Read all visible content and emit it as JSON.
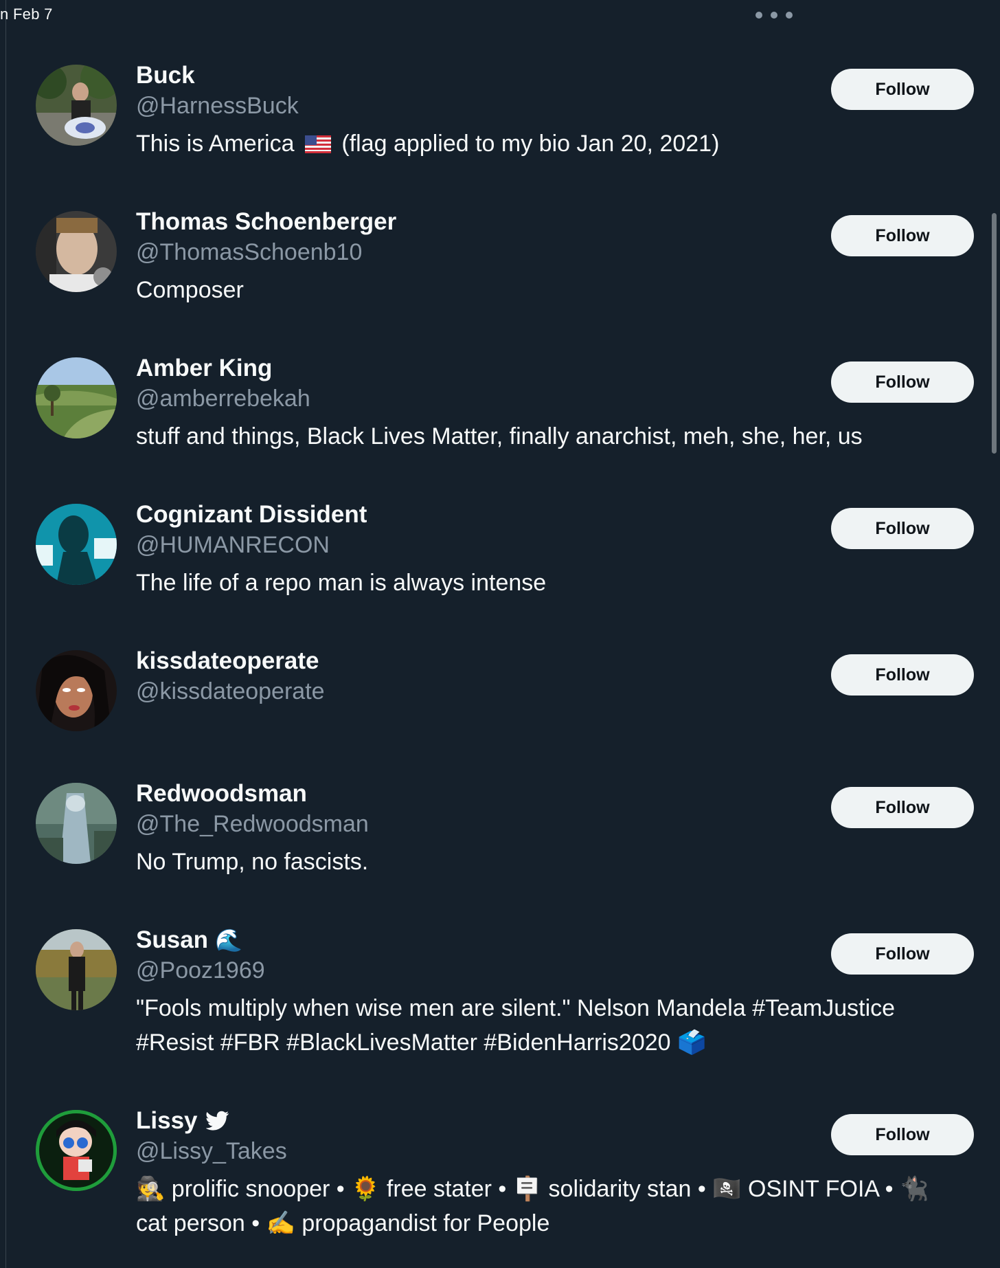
{
  "header": {
    "date_fragment": "n Feb 7",
    "more_icon": "ellipsis-icon"
  },
  "users": [
    {
      "name": "Buck",
      "handle": "@HarnessBuck",
      "bio_before_flag": "This is America ",
      "bio_after_flag": " (flag applied to my bio Jan 20, 2021)",
      "follow_label": "Follow"
    },
    {
      "name": "Thomas Schoenberger",
      "handle": "@ThomasSchoenb10",
      "bio": "Composer",
      "follow_label": "Follow"
    },
    {
      "name": "Amber King",
      "handle": "@amberrebekah",
      "bio": "stuff and things, Black Lives Matter, finally anarchist, meh, she, her, us",
      "follow_label": "Follow"
    },
    {
      "name": "Cognizant Dissident",
      "handle": "@HUMANRECON",
      "bio": "The life of a repo man is always intense",
      "follow_label": "Follow"
    },
    {
      "name": "kissdateoperate",
      "handle": "@kissdateoperate",
      "follow_label": "Follow"
    },
    {
      "name": "Redwoodsman",
      "handle": "@The_Redwoodsman",
      "bio": "No Trump, no fascists.",
      "follow_label": "Follow"
    },
    {
      "name": "Susan",
      "name_emoji": "🌊",
      "handle": "@Pooz1969",
      "bio": "\"Fools multiply when wise men are silent.\" Nelson Mandela #TeamJustice #Resist #FBR #BlackLivesMatter #BidenHarris2020 🗳️",
      "follow_label": "Follow"
    },
    {
      "name": "Lissy",
      "handle": "@Lissy_Takes",
      "bio": "🕵️ prolific snooper • 🌻 free stater • 🪧 solidarity stan • 🏴‍☠️ OSINT FOIA • 🐈‍⬛ cat person • ✍️ propagandist for People",
      "follow_label": "Follow"
    }
  ],
  "colors": {
    "background": "#15202b",
    "primary_text": "#f7f9f9",
    "secondary_text": "#8b98a5",
    "button_bg": "#eff3f4",
    "button_text": "#0f1419"
  }
}
